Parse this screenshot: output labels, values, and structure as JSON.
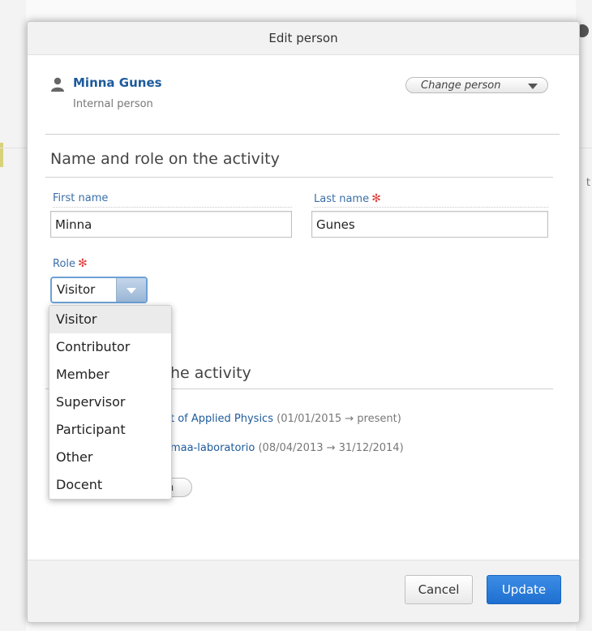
{
  "dialog": {
    "title": "Edit person"
  },
  "person": {
    "name": "Minna Gunes",
    "type": "Internal person",
    "change_label": "Change person"
  },
  "section1": {
    "title": "Name and role on the activity"
  },
  "fields": {
    "first_name_label": "First name",
    "first_name_value": "Minna",
    "last_name_label": "Last name",
    "last_name_value": "Gunes",
    "role_label": "Role",
    "role_value": "Visitor",
    "required_mark": "✻"
  },
  "section2": {
    "title_visible": "he activity"
  },
  "affiliations": [
    {
      "name": "t of Applied Physics",
      "dates": "(01/01/2015 → present)"
    },
    {
      "name": "maa-laboratorio",
      "dates": "(08/04/2013 → 31/12/2014)"
    }
  ],
  "pill_button_visible": "n",
  "role_options": [
    "Visitor",
    "Contributor",
    "Member",
    "Supervisor",
    "Participant",
    "Other",
    "Docent"
  ],
  "footer": {
    "cancel_label": "Cancel",
    "update_label": "Update"
  },
  "background": {
    "peek_text": "t"
  },
  "colors": {
    "link": "#1d5a9b",
    "label": "#3a6fa8",
    "required": "#e04040",
    "primary": "#1e6fd0"
  }
}
